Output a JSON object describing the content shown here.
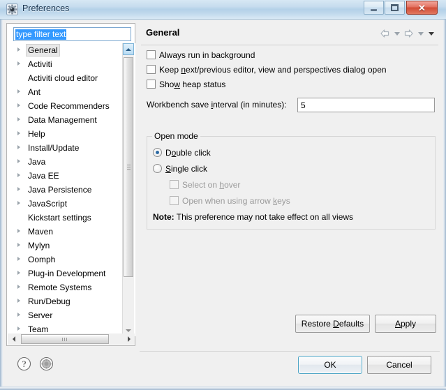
{
  "window": {
    "title": "Preferences",
    "icon": "preferences-gear-icon",
    "caption_buttons": {
      "minimize": "minimize-button",
      "maximize": "maximize-button",
      "close_glyph": "✕"
    }
  },
  "filter": {
    "placeholder": "type filter text",
    "value": "type filter text"
  },
  "tree": {
    "items": [
      {
        "label": "General",
        "expandable": true,
        "selected": true
      },
      {
        "label": "Activiti",
        "expandable": true,
        "selected": false
      },
      {
        "label": "Activiti cloud editor",
        "expandable": false,
        "selected": false
      },
      {
        "label": "Ant",
        "expandable": true,
        "selected": false
      },
      {
        "label": "Code Recommenders",
        "expandable": true,
        "selected": false
      },
      {
        "label": "Data Management",
        "expandable": true,
        "selected": false
      },
      {
        "label": "Help",
        "expandable": true,
        "selected": false
      },
      {
        "label": "Install/Update",
        "expandable": true,
        "selected": false
      },
      {
        "label": "Java",
        "expandable": true,
        "selected": false
      },
      {
        "label": "Java EE",
        "expandable": true,
        "selected": false
      },
      {
        "label": "Java Persistence",
        "expandable": true,
        "selected": false
      },
      {
        "label": "JavaScript",
        "expandable": true,
        "selected": false
      },
      {
        "label": "Kickstart settings",
        "expandable": false,
        "selected": false
      },
      {
        "label": "Maven",
        "expandable": true,
        "selected": false
      },
      {
        "label": "Mylyn",
        "expandable": true,
        "selected": false
      },
      {
        "label": "Oomph",
        "expandable": true,
        "selected": false
      },
      {
        "label": "Plug-in Development",
        "expandable": true,
        "selected": false
      },
      {
        "label": "Remote Systems",
        "expandable": true,
        "selected": false
      },
      {
        "label": "Run/Debug",
        "expandable": true,
        "selected": false
      },
      {
        "label": "Server",
        "expandable": true,
        "selected": false
      },
      {
        "label": "Team",
        "expandable": true,
        "selected": false
      }
    ]
  },
  "page": {
    "title": "General",
    "nav": {
      "back": "back-arrow",
      "back_menu": "back-dropdown",
      "forward": "forward-arrow",
      "forward_menu": "forward-dropdown",
      "view_menu": "view-menu-dropdown"
    },
    "checkboxes": [
      {
        "label": "Always run in background",
        "checked": false,
        "enabled": true
      },
      {
        "label": "Keep next/previous editor, view and perspectives dialog open",
        "checked": false,
        "enabled": true
      },
      {
        "label": "Show heap status",
        "checked": false,
        "enabled": true
      }
    ],
    "interval": {
      "label": "Workbench save interval (in minutes):",
      "value": "5"
    },
    "open_mode": {
      "legend": "Open mode",
      "options": [
        {
          "label": "Double click",
          "selected": true
        },
        {
          "label": "Single click",
          "selected": false
        }
      ],
      "sub_options": [
        {
          "label": "Select on hover",
          "checked": false,
          "enabled": false
        },
        {
          "label": "Open when using arrow keys",
          "checked": false,
          "enabled": false
        }
      ],
      "note_prefix": "Note:",
      "note_text": "This preference may not take effect on all views"
    },
    "buttons": {
      "restore_defaults": "Restore Defaults",
      "apply": "Apply"
    }
  },
  "dialog_buttons": {
    "help": "help-button",
    "preferences_shortcut": "preferences-shortcut-button",
    "ok": "OK",
    "cancel": "Cancel"
  },
  "colors": {
    "title_bar": "#bfd8ec",
    "close_button": "#d14b35",
    "selection": "#3399ff",
    "default_button_border": "#4aa3c4",
    "panel_bg": "#f0f0f0"
  }
}
